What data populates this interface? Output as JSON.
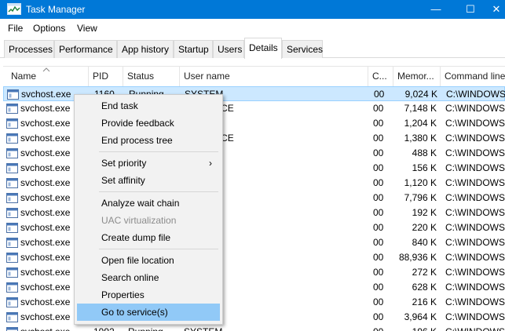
{
  "window": {
    "title": "Task Manager",
    "minimize": "—",
    "maximize": "☐",
    "close": "✕"
  },
  "menu": [
    "File",
    "Options",
    "View"
  ],
  "tabs": [
    "Processes",
    "Performance",
    "App history",
    "Startup",
    "Users",
    "Details",
    "Services"
  ],
  "active_tab": "Details",
  "columns": [
    "Name",
    "PID",
    "Status",
    "User name",
    "C...",
    "Memor...",
    "Command line"
  ],
  "rows": [
    {
      "name": "svchost.exe",
      "pid": "1160",
      "status": "Running",
      "user": "SYSTEM",
      "cpu": "00",
      "mem": "9,024 K",
      "cmd": "C:\\WINDOWS\\"
    },
    {
      "name": "svchost.exe",
      "pid": "",
      "status": "",
      "user": "K SERVICE",
      "cpu": "00",
      "mem": "7,148 K",
      "cmd": "C:\\WINDOWS\\"
    },
    {
      "name": "svchost.exe",
      "pid": "",
      "status": "",
      "user": "",
      "cpu": "00",
      "mem": "1,204 K",
      "cmd": "C:\\WINDOWS\\"
    },
    {
      "name": "svchost.exe",
      "pid": "",
      "status": "",
      "user": "K SERVICE",
      "cpu": "00",
      "mem": "1,380 K",
      "cmd": "C:\\WINDOWS\\"
    },
    {
      "name": "svchost.exe",
      "pid": "",
      "status": "",
      "user": "",
      "cpu": "00",
      "mem": "488 K",
      "cmd": "C:\\WINDOWS\\"
    },
    {
      "name": "svchost.exe",
      "pid": "",
      "status": "",
      "user": "",
      "cpu": "00",
      "mem": "156 K",
      "cmd": "C:\\WINDOWS\\"
    },
    {
      "name": "svchost.exe",
      "pid": "",
      "status": "",
      "user": "ERVICE",
      "cpu": "00",
      "mem": "1,120 K",
      "cmd": "C:\\WINDOWS\\"
    },
    {
      "name": "svchost.exe",
      "pid": "",
      "status": "",
      "user": "ERVICE",
      "cpu": "00",
      "mem": "7,796 K",
      "cmd": "C:\\WINDOWS\\"
    },
    {
      "name": "svchost.exe",
      "pid": "",
      "status": "",
      "user": "ERVICE",
      "cpu": "00",
      "mem": "192 K",
      "cmd": "C:\\WINDOWS\\"
    },
    {
      "name": "svchost.exe",
      "pid": "",
      "status": "",
      "user": "",
      "cpu": "00",
      "mem": "220 K",
      "cmd": "C:\\WINDOWS\\"
    },
    {
      "name": "svchost.exe",
      "pid": "",
      "status": "",
      "user": "",
      "cpu": "00",
      "mem": "840 K",
      "cmd": "C:\\WINDOWS\\"
    },
    {
      "name": "svchost.exe",
      "pid": "",
      "status": "",
      "user": "",
      "cpu": "00",
      "mem": "88,936 K",
      "cmd": "C:\\WINDOWS\\"
    },
    {
      "name": "svchost.exe",
      "pid": "",
      "status": "",
      "user": "",
      "cpu": "00",
      "mem": "272 K",
      "cmd": "C:\\WINDOWS\\"
    },
    {
      "name": "svchost.exe",
      "pid": "",
      "status": "",
      "user": "ERVICE",
      "cpu": "00",
      "mem": "628 K",
      "cmd": "C:\\WINDOWS\\"
    },
    {
      "name": "svchost.exe",
      "pid": "",
      "status": "",
      "user": "ERVICE",
      "cpu": "00",
      "mem": "216 K",
      "cmd": "C:\\WINDOWS\\"
    },
    {
      "name": "svchost.exe",
      "pid": "",
      "status": "",
      "user": "",
      "cpu": "00",
      "mem": "3,964 K",
      "cmd": "C:\\WINDOWS\\"
    },
    {
      "name": "svchost.exe",
      "pid": "1992",
      "status": "Running",
      "user": "SYSTEM",
      "cpu": "00",
      "mem": "196 K",
      "cmd": "C:\\WINDOWS\\"
    }
  ],
  "context_menu": {
    "items": [
      {
        "label": "End task",
        "enabled": true
      },
      {
        "label": "Provide feedback",
        "enabled": true
      },
      {
        "label": "End process tree",
        "enabled": true
      },
      {
        "separator": true
      },
      {
        "label": "Set priority",
        "enabled": true,
        "submenu": true
      },
      {
        "label": "Set affinity",
        "enabled": true
      },
      {
        "separator": true
      },
      {
        "label": "Analyze wait chain",
        "enabled": true
      },
      {
        "label": "UAC virtualization",
        "enabled": false
      },
      {
        "label": "Create dump file",
        "enabled": true
      },
      {
        "separator": true
      },
      {
        "label": "Open file location",
        "enabled": true
      },
      {
        "label": "Search online",
        "enabled": true
      },
      {
        "label": "Properties",
        "enabled": true
      },
      {
        "label": "Go to service(s)",
        "enabled": true,
        "highlighted": true
      }
    ],
    "submenu_arrow": "›"
  },
  "colors": {
    "titlebar": "#0078d7",
    "selection": "#cce8ff",
    "menu_highlight": "#91c9f7"
  },
  "icons": {
    "app": "task-manager-icon",
    "process": "process-window-icon",
    "sort": "sort-ascending-caret"
  }
}
